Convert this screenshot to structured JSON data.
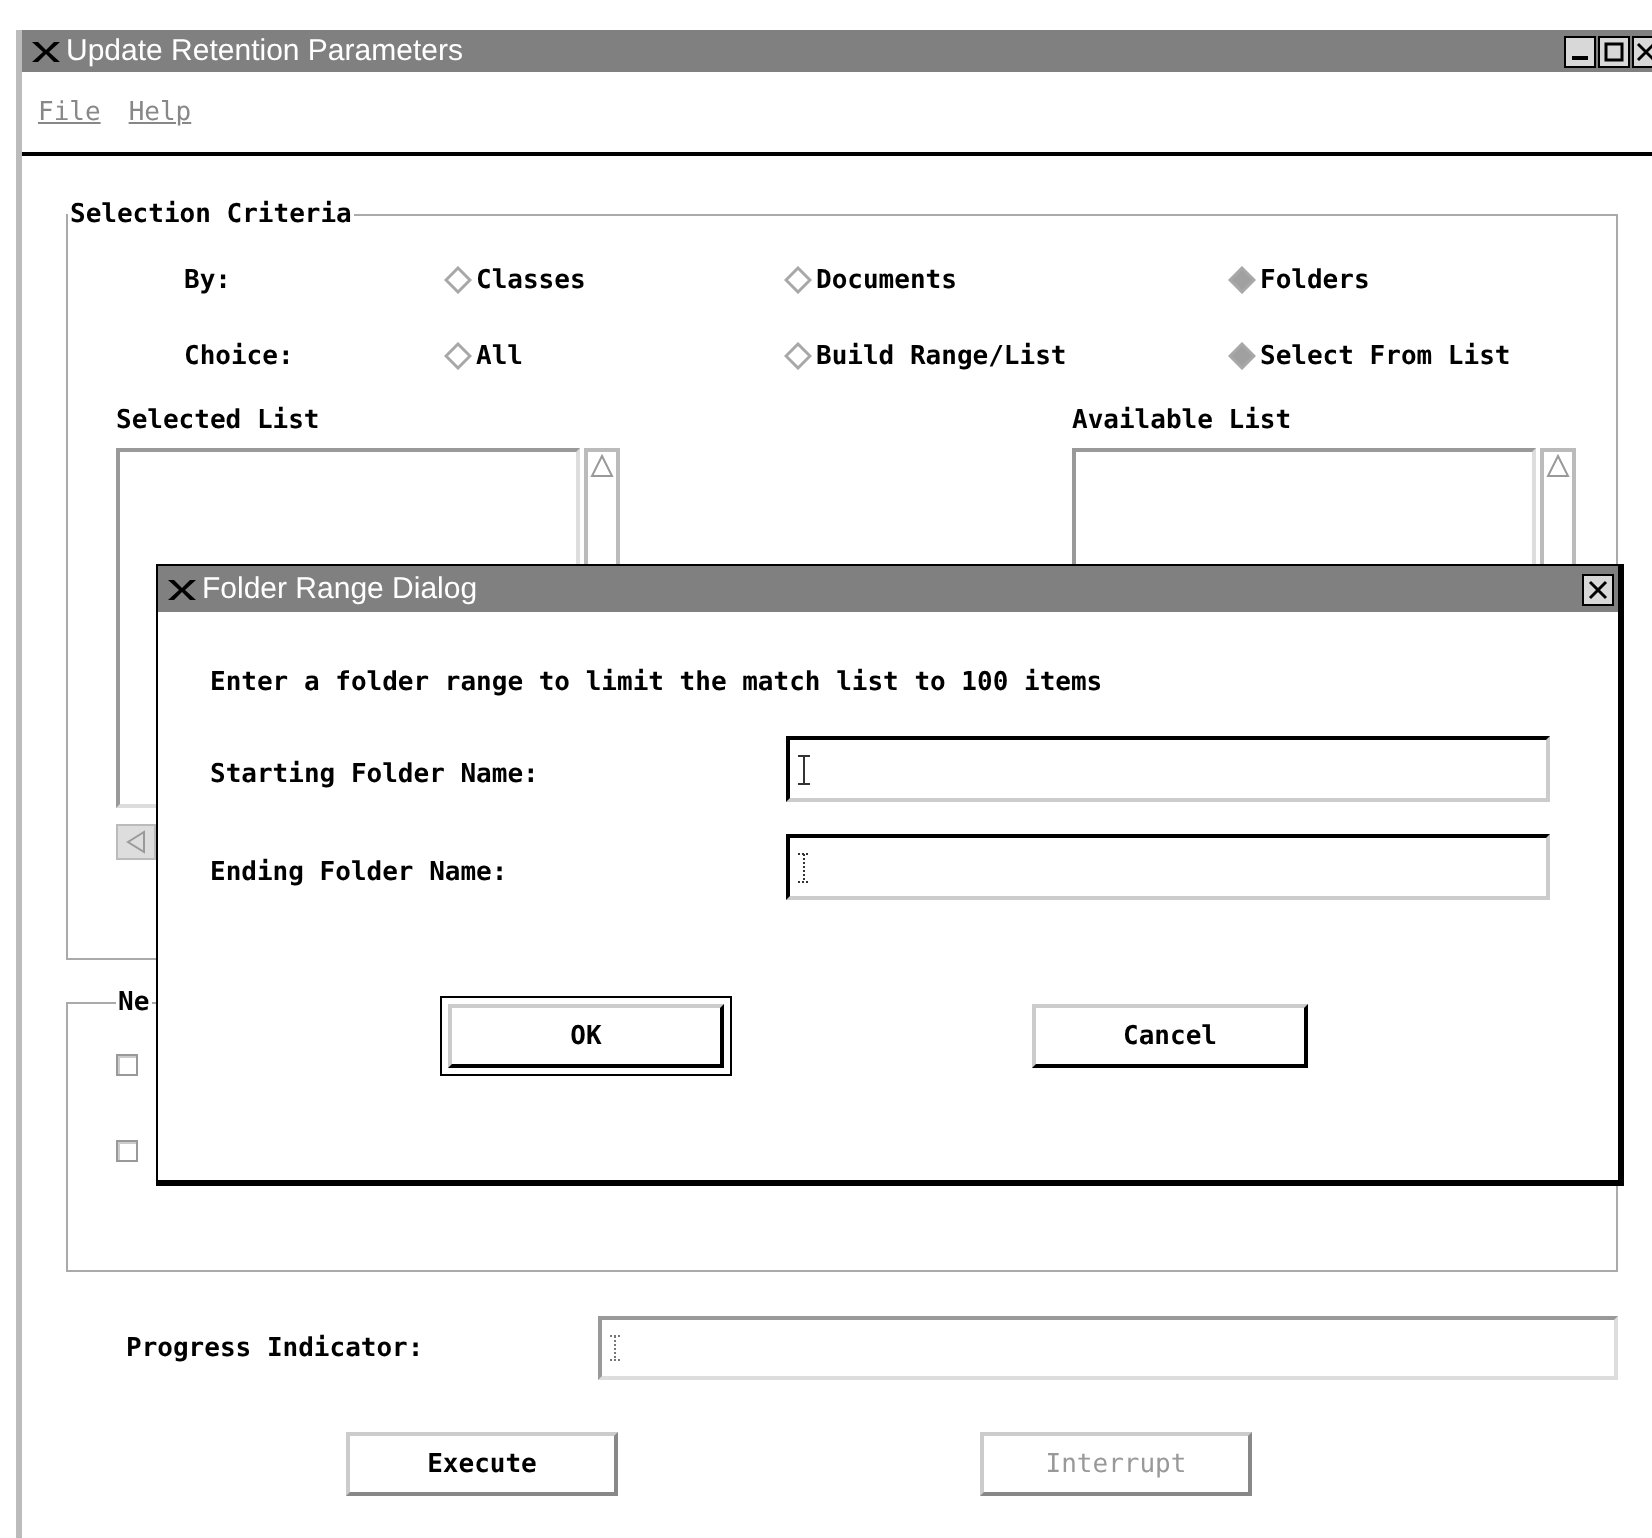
{
  "window": {
    "title": "Update Retention Parameters"
  },
  "menu": [
    {
      "label": "File"
    },
    {
      "label": "Help"
    }
  ],
  "selection_criteria": {
    "title": "Selection Criteria",
    "rows": [
      {
        "label": "By:",
        "options": [
          {
            "label": "Classes",
            "selected": false
          },
          {
            "label": "Documents",
            "selected": false
          },
          {
            "label": "Folders",
            "selected": true
          }
        ]
      },
      {
        "label": "Choice:",
        "options": [
          {
            "label": "All",
            "selected": false
          },
          {
            "label": "Build Range/List",
            "selected": false
          },
          {
            "label": "Select From List",
            "selected": true
          }
        ]
      }
    ],
    "lists": [
      {
        "label": "Selected List"
      },
      {
        "label": "Available List"
      }
    ]
  },
  "new_group": {
    "title": "Ne",
    "checkboxes": [
      {
        "checked": false
      },
      {
        "checked": false
      }
    ]
  },
  "progress": {
    "label": "Progress Indicator:"
  },
  "buttons": [
    {
      "label": "Execute",
      "disabled": false
    },
    {
      "label": "Interrupt",
      "disabled": true
    }
  ],
  "dialog": {
    "title": "Folder Range Dialog",
    "message": "Enter a folder range to limit the match list to 100 items",
    "fields": [
      {
        "label": "Starting Folder Name:"
      },
      {
        "label": "Ending Folder Name:"
      }
    ],
    "buttons": [
      {
        "label": "OK",
        "default": true
      },
      {
        "label": "Cancel",
        "default": false
      }
    ]
  }
}
